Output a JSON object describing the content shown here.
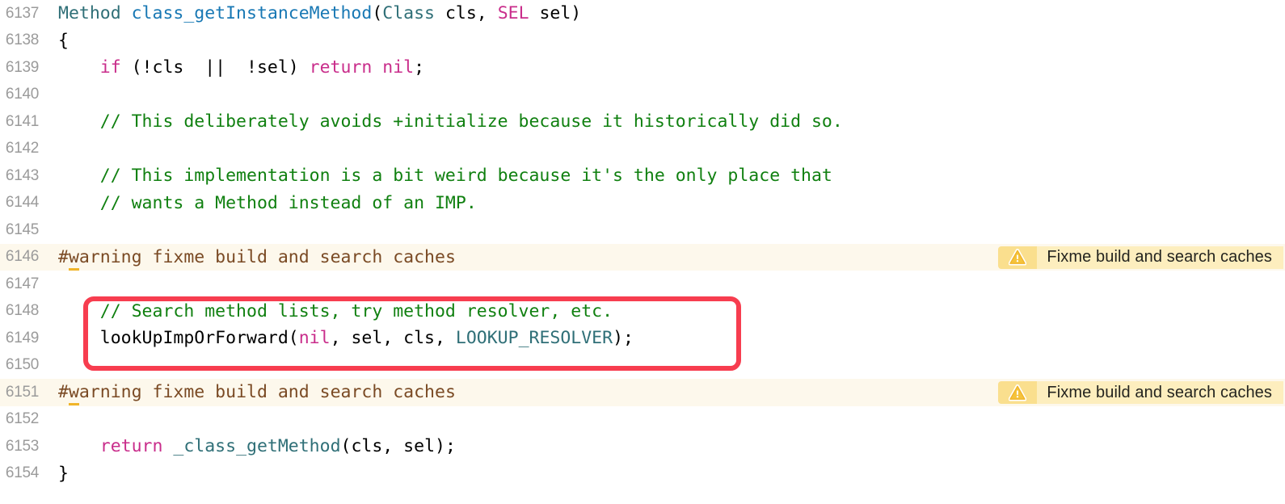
{
  "editor": {
    "background_color": "#ffffff",
    "warning_line_background": "#fdf8ec",
    "gutter_color": "#9b9b9b",
    "colors": {
      "type": "#2f6f77",
      "function": "#1878b4",
      "keyword": "#c92d8b",
      "comment": "#108010",
      "pragma": "#7a4a24",
      "pragma_underline": "#f0b429",
      "plain": "#000000",
      "badge_icon_bg": "#fadf8e",
      "badge_text_bg": "#fdeebe",
      "annotation_red": "#f73d4f"
    }
  },
  "lines": [
    {
      "number": "6137",
      "warning": false,
      "tokens": [
        {
          "text": "Method ",
          "cls": "tk-type"
        },
        {
          "text": "class_getInstanceMethod",
          "cls": "tk-func"
        },
        {
          "text": "(",
          "cls": "tk-plain"
        },
        {
          "text": "Class",
          "cls": "tk-type"
        },
        {
          "text": " cls, ",
          "cls": "tk-plain"
        },
        {
          "text": "SEL",
          "cls": "tk-kw"
        },
        {
          "text": " sel)",
          "cls": "tk-plain"
        }
      ]
    },
    {
      "number": "6138",
      "warning": false,
      "tokens": [
        {
          "text": "{",
          "cls": "tk-plain"
        }
      ]
    },
    {
      "number": "6139",
      "warning": false,
      "tokens": [
        {
          "text": "    ",
          "cls": "tk-plain"
        },
        {
          "text": "if",
          "cls": "tk-kw"
        },
        {
          "text": " (!cls  ||  !sel) ",
          "cls": "tk-plain"
        },
        {
          "text": "return nil",
          "cls": "tk-kw"
        },
        {
          "text": ";",
          "cls": "tk-plain"
        }
      ]
    },
    {
      "number": "6140",
      "warning": false,
      "tokens": []
    },
    {
      "number": "6141",
      "warning": false,
      "tokens": [
        {
          "text": "    // This deliberately avoids +initialize because it historically did so.",
          "cls": "tk-comment"
        }
      ]
    },
    {
      "number": "6142",
      "warning": false,
      "tokens": []
    },
    {
      "number": "6143",
      "warning": false,
      "tokens": [
        {
          "text": "    // This implementation is a bit weird because it's the only place that",
          "cls": "tk-comment"
        }
      ]
    },
    {
      "number": "6144",
      "warning": false,
      "tokens": [
        {
          "text": "    // wants a Method instead of an IMP.",
          "cls": "tk-comment"
        }
      ]
    },
    {
      "number": "6145",
      "warning": false,
      "tokens": []
    },
    {
      "number": "6146",
      "warning": true,
      "badge_label": "Fixme build and search caches",
      "badge_icon": "warning-triangle-icon",
      "tokens": [
        {
          "text": "#",
          "cls": "tk-pragma"
        },
        {
          "text": "w",
          "cls": "tk-pragma",
          "underline": true
        },
        {
          "text": "arning fixme build and search caches",
          "cls": "tk-pragma"
        }
      ]
    },
    {
      "number": "6147",
      "warning": false,
      "tokens": []
    },
    {
      "number": "6148",
      "warning": false,
      "tokens": [
        {
          "text": "    // Search method lists, try method resolver, etc.",
          "cls": "tk-comment"
        }
      ]
    },
    {
      "number": "6149",
      "warning": false,
      "tokens": [
        {
          "text": "    lookUpImpOrForward(",
          "cls": "tk-plain"
        },
        {
          "text": "nil",
          "cls": "tk-kw"
        },
        {
          "text": ", sel, cls, ",
          "cls": "tk-plain"
        },
        {
          "text": "LOOKUP_RESOLVER",
          "cls": "tk-type"
        },
        {
          "text": ");",
          "cls": "tk-plain"
        }
      ]
    },
    {
      "number": "6150",
      "warning": false,
      "tokens": []
    },
    {
      "number": "6151",
      "warning": true,
      "badge_label": "Fixme build and search caches",
      "badge_icon": "warning-triangle-icon",
      "tokens": [
        {
          "text": "#",
          "cls": "tk-pragma"
        },
        {
          "text": "w",
          "cls": "tk-pragma",
          "underline": true
        },
        {
          "text": "arning fixme build and search caches",
          "cls": "tk-pragma"
        }
      ]
    },
    {
      "number": "6152",
      "warning": false,
      "tokens": []
    },
    {
      "number": "6153",
      "warning": false,
      "tokens": [
        {
          "text": "    ",
          "cls": "tk-plain"
        },
        {
          "text": "return",
          "cls": "tk-kw"
        },
        {
          "text": " ",
          "cls": "tk-plain"
        },
        {
          "text": "_class_getMethod",
          "cls": "tk-type"
        },
        {
          "text": "(cls, sel);",
          "cls": "tk-plain"
        }
      ]
    },
    {
      "number": "6154",
      "warning": false,
      "tokens": [
        {
          "text": "}",
          "cls": "tk-plain"
        }
      ]
    }
  ],
  "annotation": {
    "type": "red-rounded-rectangle",
    "covers_lines": [
      "6148",
      "6149"
    ],
    "color": "#f73d4f"
  }
}
